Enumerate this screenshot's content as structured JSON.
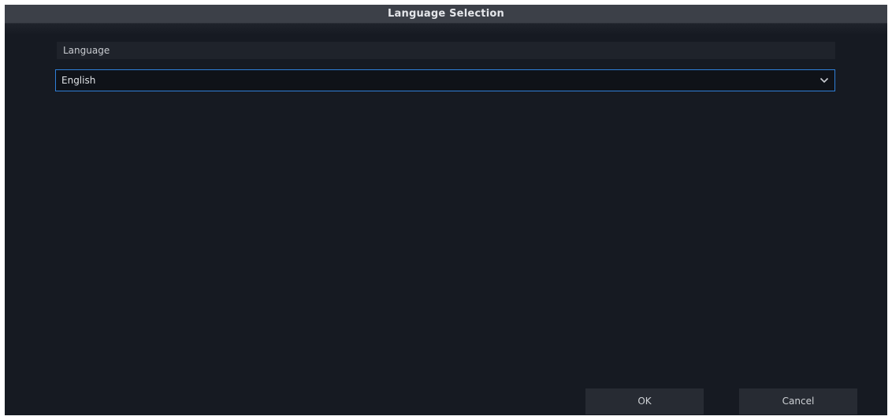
{
  "dialog": {
    "title": "Language Selection"
  },
  "language": {
    "label": "Language",
    "selected": "English"
  },
  "buttons": {
    "ok": "OK",
    "cancel": "Cancel"
  },
  "colors": {
    "background": "#161a22",
    "titlebar": "#3c4048",
    "focus_border": "#2f7fd8"
  },
  "icons": {
    "dropdown": "chevron-down-icon"
  }
}
